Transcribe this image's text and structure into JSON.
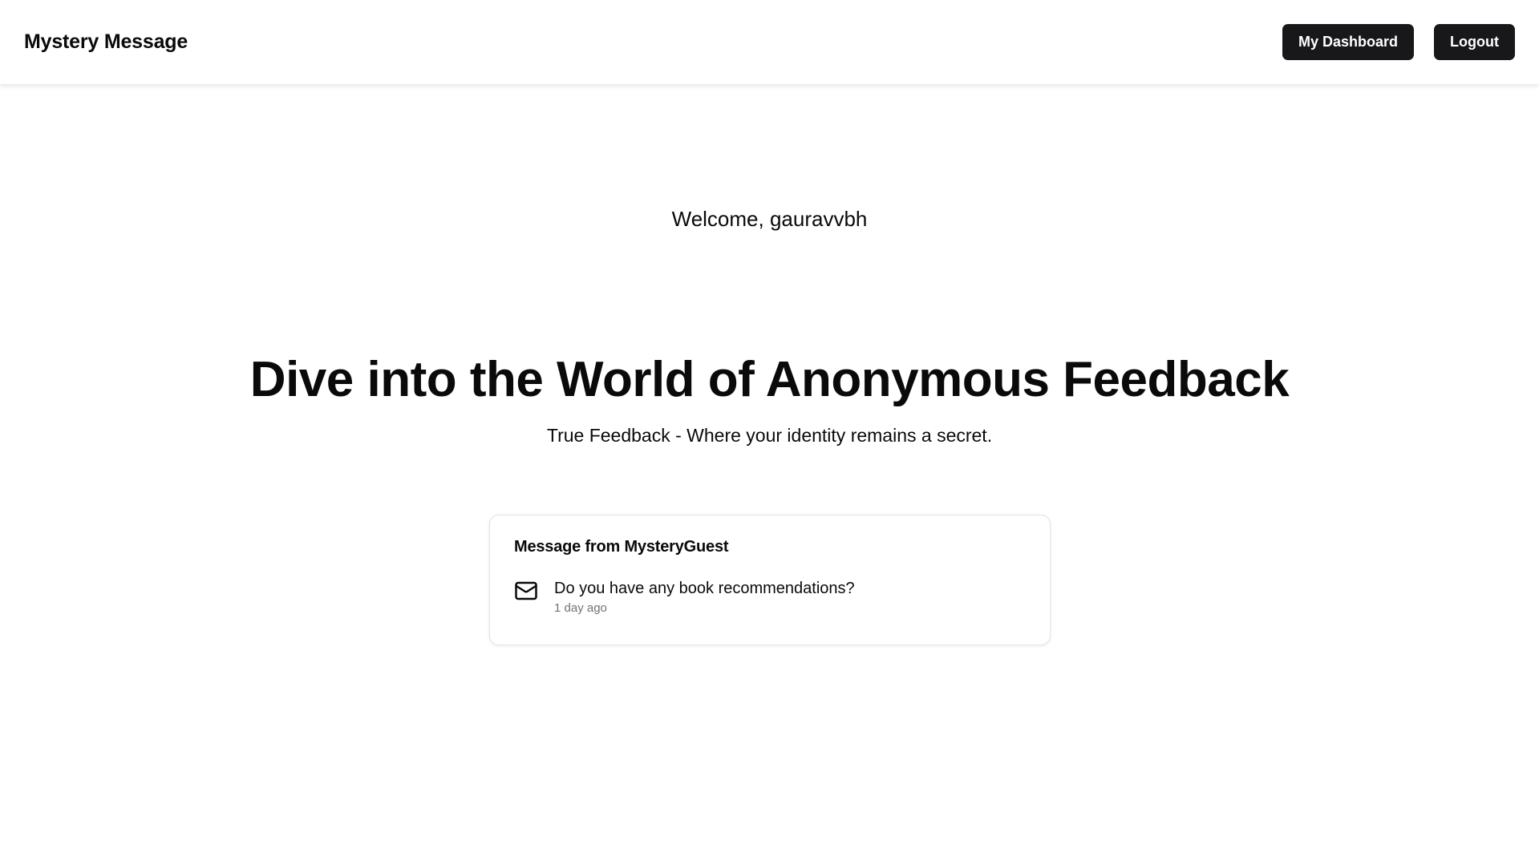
{
  "navbar": {
    "brand": "Mystery Message",
    "dashboard_label": "My Dashboard",
    "logout_label": "Logout"
  },
  "hero": {
    "welcome": "Welcome, gauravvbh",
    "headline": "Dive into the World of Anonymous Feedback",
    "subline": "True Feedback - Where your identity remains a secret."
  },
  "message_card": {
    "title": "Message from MysteryGuest",
    "icon": "mail-icon",
    "content": "Do you have any book recommendations?",
    "time": "1 day ago"
  },
  "colors": {
    "button_bg": "#18181b",
    "button_text": "#ffffff",
    "muted_text": "#71717a",
    "border": "#e4e4e7"
  }
}
